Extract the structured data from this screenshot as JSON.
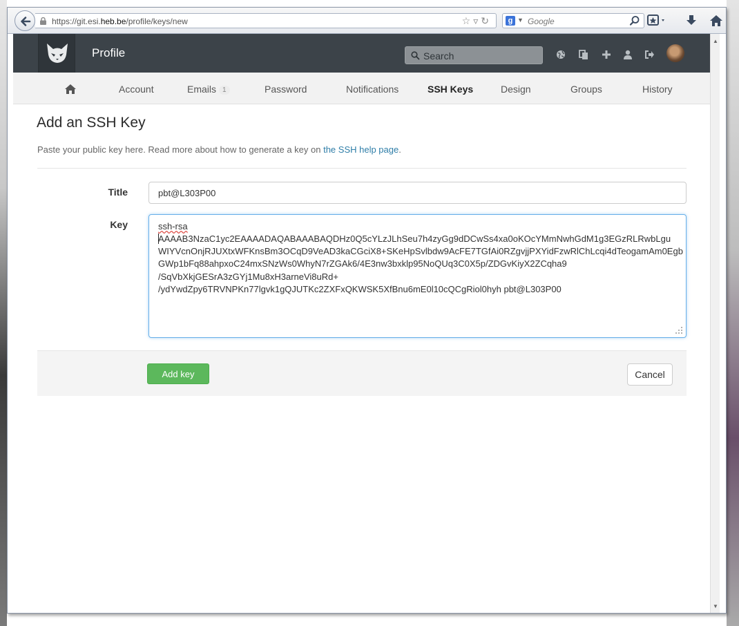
{
  "browser": {
    "url_prefix": "https://git.esi.",
    "url_domain": "heb.be",
    "url_path": "/profile/keys/new",
    "search_engine_logo": "g",
    "search_placeholder": "Google"
  },
  "header": {
    "title": "Profile",
    "search_placeholder": "Search",
    "icons": [
      "globe-icon",
      "copy-icon",
      "plus-icon",
      "user-icon",
      "sign-out-icon"
    ]
  },
  "tabs": {
    "account": "Account",
    "emails": "Emails",
    "emails_count": "1",
    "password": "Password",
    "notifications": "Notifications",
    "ssh_keys": "SSH Keys",
    "design": "Design",
    "groups": "Groups",
    "history": "History",
    "active": "ssh_keys"
  },
  "page": {
    "title": "Add an SSH Key",
    "description": "Paste your public key here. Read more about how to generate a key on ",
    "help_link": "the SSH help page",
    "description_end": "."
  },
  "form": {
    "title_label": "Title",
    "title_value": "pbt@L303P00",
    "key_label": "Key",
    "key_lines": [
      "ssh-rsa",
      "AAAAB3NzaC1yc2EAAAADAQABAAABAQDHz0Q5cYLzJLhSeu7h4zyGg9dDCwSs4xa0oKOcYMmNwhGdM1g3EGzRLRwbLgu",
      "WIYVcnOnjRJUXtxWFKnsBm3OCqD9VeAD3kaCGciX8+SKeHpSvlbdw9AcFE7TGfAi0RZgvjjPXYidFzwRlChLcqi4dTeogamAm0Egb",
      "GWp1bFq88ahpxoC24mxSNzWs0WhyN7rZGAk6/4E3nw3bxklp95NoQUq3C0X5p/ZDGvKiyX2ZCqha9",
      "/SqVbXkjGESrA3zGYj1Mu8xH3arneVi8uRd+",
      "/ydYwdZpy6TRVNPKn77lgvk1gQJUTKc2ZXFxQKWSK5XfBnu6mE0l10cQCgRiol0hyh pbt@L303P00"
    ],
    "add_button": "Add key",
    "cancel_button": "Cancel"
  },
  "colors": {
    "header_bg": "#3c4349",
    "tabs_bg": "#f2f2f2",
    "link": "#2f7ea8",
    "add_button": "#5cb85c",
    "focus_border": "#66afe9"
  }
}
